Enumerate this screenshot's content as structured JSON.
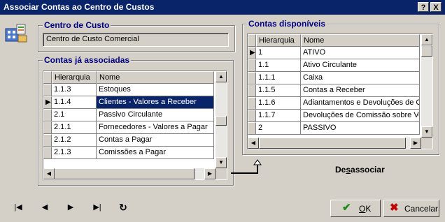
{
  "window": {
    "title": "Associar Contas ao Centro de Custos",
    "help_btn": "?",
    "close_btn": "X"
  },
  "centro_custo": {
    "legend": "Centro de Custo",
    "value": "Centro de Custo Comercial"
  },
  "associadas": {
    "legend": "Contas já associadas",
    "headers": [
      "Hierarquia",
      "Nome"
    ],
    "rows": [
      {
        "hier": "1.1.3",
        "nome": "Estoques"
      },
      {
        "hier": "1.1.4",
        "nome": "Clientes - Valores a Receber"
      },
      {
        "hier": "2.1",
        "nome": "Passivo Circulante"
      },
      {
        "hier": "2.1.1",
        "nome": "Fornecedores - Valores a Pagar"
      },
      {
        "hier": "2.1.2",
        "nome": "Contas a Pagar"
      },
      {
        "hier": "2.1.3",
        "nome": "Comissões a Pagar"
      }
    ]
  },
  "disponiveis": {
    "legend": "Contas disponíveis",
    "headers": [
      "Hierarquia",
      "Nome"
    ],
    "rows": [
      {
        "hier": "1",
        "nome": "ATIVO"
      },
      {
        "hier": "1.1",
        "nome": "Ativo Circulante"
      },
      {
        "hier": "1.1.1",
        "nome": "Caixa"
      },
      {
        "hier": "1.1.5",
        "nome": "Contas a Receber"
      },
      {
        "hier": "1.1.6",
        "nome": "Adiantamentos e Devoluções de Co"
      },
      {
        "hier": "1.1.7",
        "nome": "Devoluções de Comissão sobre Ven"
      },
      {
        "hier": "2",
        "nome": "PASSIVO"
      }
    ]
  },
  "actions": {
    "desassociar": "Desassociar",
    "ok": "OK",
    "cancelar": "Cancelar"
  },
  "nav": {
    "first": "|◀",
    "prev": "◀",
    "next": "▶",
    "last": "▶|",
    "refresh": "↻"
  },
  "colors": {
    "titlebar": "#0a246a",
    "legend_text": "#000080",
    "selection": "#0a246a",
    "face": "#d4d0c8",
    "ok_check": "#1a8a1a",
    "cancel_x": "#c00000"
  }
}
